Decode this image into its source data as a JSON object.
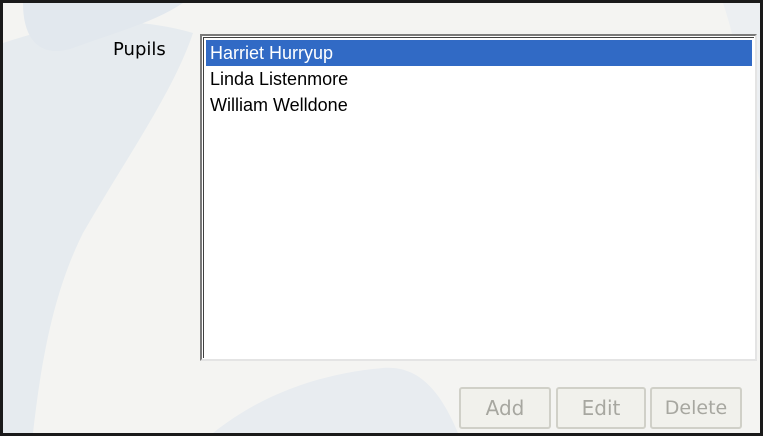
{
  "form": {
    "pupils_label": "Pupils",
    "pupils": [
      {
        "name": "Harriet Hurryup",
        "selected": true
      },
      {
        "name": "Linda Listenmore",
        "selected": false
      },
      {
        "name": "William Welldone",
        "selected": false
      }
    ]
  },
  "buttons": {
    "add_label": "Add",
    "edit_label": "Edit",
    "delete_label": "Delete",
    "enabled": false
  },
  "colors": {
    "selection": "#316ac5",
    "panel_background": "#f4f4f2",
    "disabled_text": "#a7a7a0",
    "border": "#1a1a1a"
  }
}
